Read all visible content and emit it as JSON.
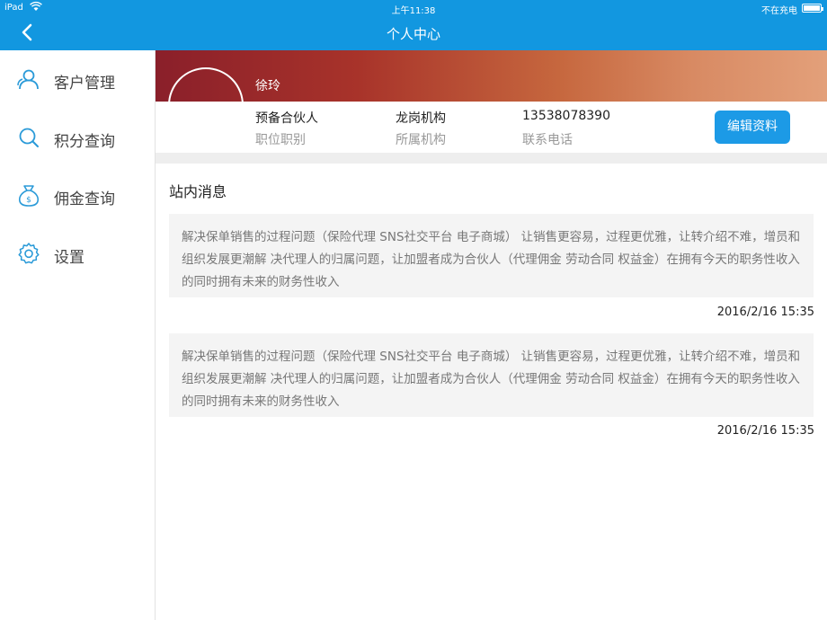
{
  "status_bar": {
    "device": "iPad",
    "time": "上午11:38",
    "charging": "不在充电"
  },
  "header": {
    "title": "个人中心"
  },
  "sidebar": {
    "items": [
      {
        "label": "客户管理",
        "icon": "user-icon"
      },
      {
        "label": "积分查询",
        "icon": "search-icon"
      },
      {
        "label": "佣金查询",
        "icon": "money-bag-icon"
      },
      {
        "label": "设置",
        "icon": "gear-icon"
      }
    ]
  },
  "profile": {
    "name": "徐玲",
    "position": {
      "value": "预备合伙人",
      "label": "职位职别"
    },
    "org": {
      "value": "龙岗机构",
      "label": "所属机构"
    },
    "phone": {
      "value": "13538078390",
      "label": "联系电话"
    },
    "edit_label": "编辑资料"
  },
  "messages": {
    "title": "站内消息",
    "items": [
      {
        "text": "解决保单销售的过程问题（保险代理 SNS社交平台 电子商城） 让销售更容易，过程更优雅，让转介绍不难，增员和组织发展更潮解 决代理人的归属问题，让加盟者成为合伙人（代理佣金 劳动合同 权益金）在拥有今天的职务性收入的同时拥有未来的财务性收入",
        "time": "2016/2/16 15:35"
      },
      {
        "text": "解决保单销售的过程问题（保险代理 SNS社交平台 电子商城） 让销售更容易，过程更优雅，让转介绍不难，增员和组织发展更潮解 决代理人的归属问题，让加盟者成为合伙人（代理佣金 劳动合同 权益金）在拥有今天的职务性收入的同时拥有未来的财务性收入",
        "time": "2016/2/16 15:35"
      }
    ]
  },
  "colors": {
    "accent": "#1297e0",
    "button": "#1c9ae6",
    "icon": "#2a9ad8"
  }
}
